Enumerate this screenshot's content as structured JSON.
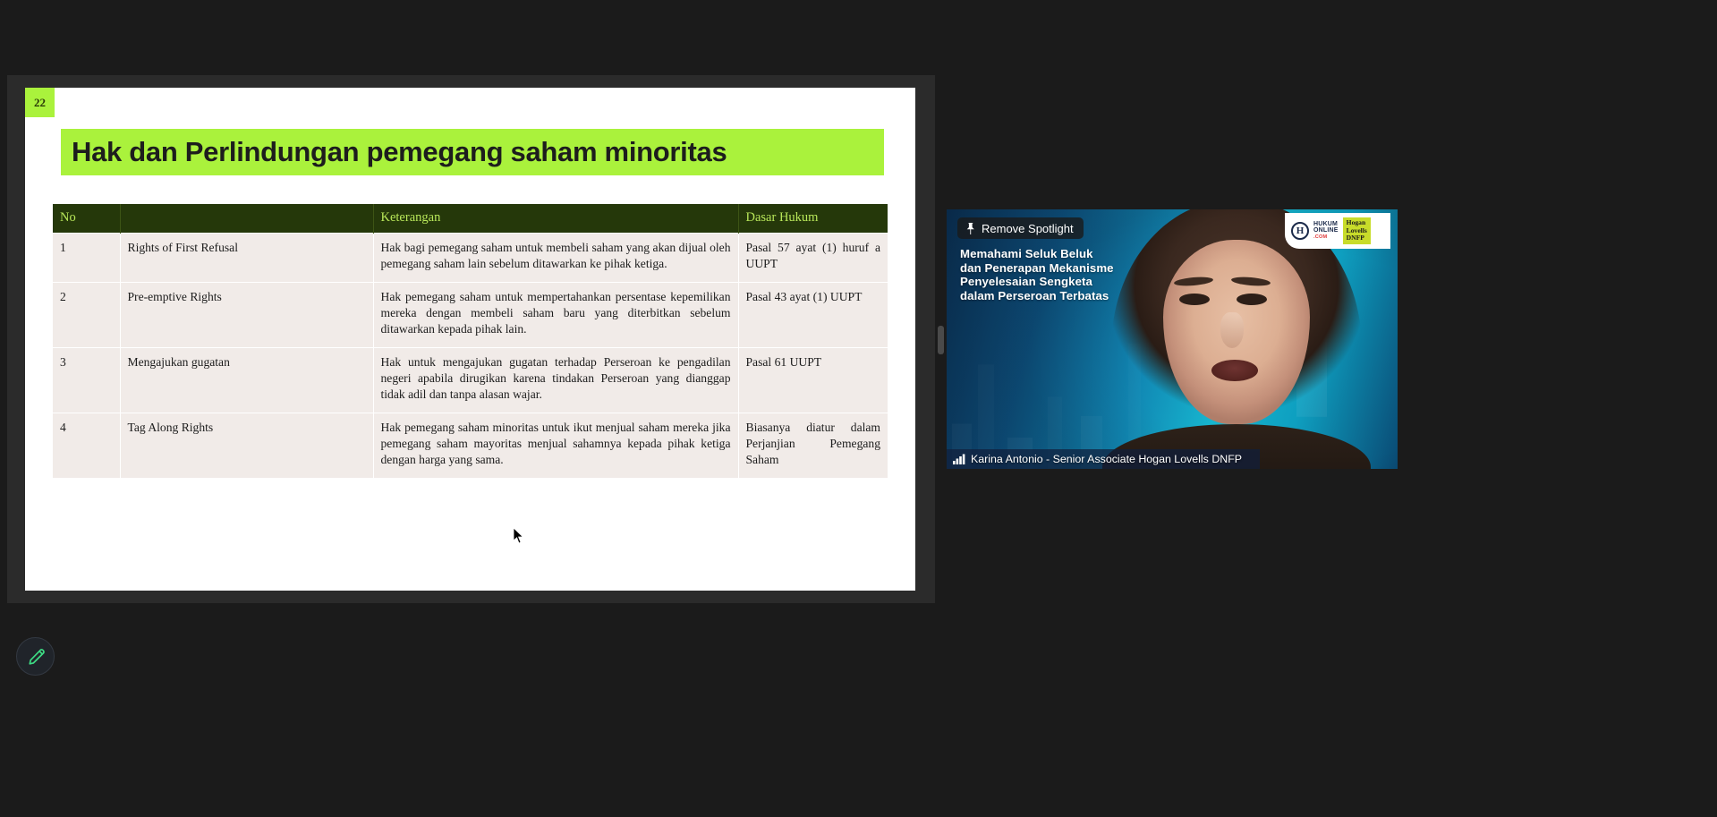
{
  "app": {
    "window_title": "Zoom Meeting - Screen Share",
    "background_color": "#1b1b1b",
    "share_stage_color": "#2b2b2b"
  },
  "slide": {
    "page_number": "22",
    "title": "Hak dan Perlindungan pemegang saham minoritas",
    "accent_color": "#aaf23c",
    "header_color": "#25380a",
    "header_text_color": "#b9e85a",
    "row_color": "#f1ebe8",
    "table": {
      "columns": [
        "No",
        "",
        "Keterangan",
        "Dasar Hukum"
      ],
      "rows": [
        {
          "no": "1",
          "term": "Rights of First Refusal",
          "keterangan": "Hak bagi pemegang saham untuk membeli saham yang akan dijual oleh pemegang saham lain sebelum ditawarkan ke pihak ketiga.",
          "dasar_hukum": "Pasal 57 ayat (1) huruf a UUPT"
        },
        {
          "no": "2",
          "term": "Pre-emptive Rights",
          "keterangan": "Hak pemegang saham untuk mempertahankan persentase kepemilikan mereka dengan membeli saham baru yang diterbitkan sebelum ditawarkan kepada pihak lain.",
          "dasar_hukum": "Pasal 43 ayat (1) UUPT"
        },
        {
          "no": "3",
          "term": "Mengajukan gugatan",
          "keterangan": "Hak untuk mengajukan gugatan terhadap Perseroan ke pengadilan negeri apabila dirugikan karena tindakan Perseroan yang dianggap tidak adil dan tanpa alasan wajar.",
          "dasar_hukum": "Pasal 61 UUPT"
        },
        {
          "no": "4",
          "term": "Tag Along Rights",
          "keterangan": "Hak pemegang saham minoritas untuk ikut menjual saham mereka jika pemegang saham mayoritas menjual sahamnya kepada pihak ketiga dengan harga yang sama.",
          "dasar_hukum": "Biasanya diatur dalam Perjanjian Pemegang Saham"
        }
      ]
    }
  },
  "video": {
    "spotlight_button_label": "Remove Spotlight",
    "spotlight_icon": "pin-icon",
    "headline_lines": [
      "Memahami Seluk Beluk",
      "dan Penerapan Mekanisme",
      "Penyelesaian Sengketa",
      "dalam Perseroan Terbatas"
    ],
    "participant_name": "Karina Antonio - Senior Associate Hogan Lovells DNFP",
    "name_icon": "signal-bars-icon",
    "logos": {
      "hukumonline_mark": "H",
      "hukumonline_line1": "HUKUM",
      "hukumonline_line2": "ONLINE",
      "hukumonline_line3": ".COM",
      "hogan_line1": "Hogan",
      "hogan_line2": "Lovells",
      "hogan_line3": "DNFP",
      "hogan_bg": "#c8dc2a"
    }
  },
  "toolbar": {
    "annotate_icon": "pencil-icon",
    "annotate_color": "#3ddc84"
  }
}
